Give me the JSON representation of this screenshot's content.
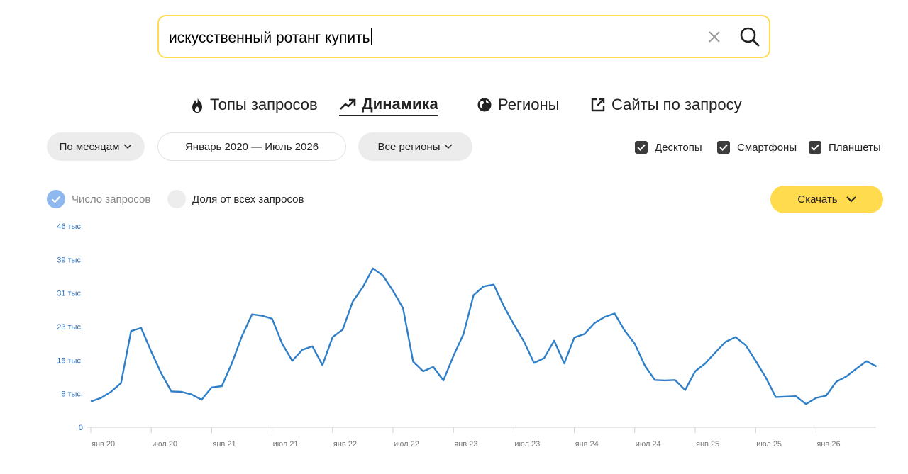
{
  "search": {
    "query": "искусственный ротанг купить"
  },
  "tabs": [
    {
      "label": "Топы запросов",
      "icon": "fire-icon"
    },
    {
      "label": "Динамика",
      "icon": "trend-icon",
      "active": true
    },
    {
      "label": "Регионы",
      "icon": "globe-icon"
    },
    {
      "label": "Сайты по запросу",
      "icon": "external-link-icon"
    }
  ],
  "filters": {
    "period": "По месяцам",
    "range": "Январь 2020 — Июль 2026",
    "region": "Все регионы"
  },
  "devices": [
    {
      "label": "Десктопы",
      "checked": true
    },
    {
      "label": "Смартфоны",
      "checked": true
    },
    {
      "label": "Планшеты",
      "checked": true
    }
  ],
  "modes": [
    {
      "label": "Число запросов",
      "selected": true
    },
    {
      "label": "Доля от всех запросов",
      "selected": false
    }
  ],
  "download_label": "Скачать",
  "colors": {
    "accent": "#ffdb4d",
    "line": "#2f7fc8",
    "tick_y": "#2d6fbd",
    "radio_on": "#8eb8ee"
  },
  "chart_data": {
    "type": "line",
    "title": "",
    "xlabel": "",
    "ylabel": "",
    "ylim": [
      0,
      46000
    ],
    "yticks": [
      0,
      7700,
      15300,
      23000,
      30700,
      38300,
      46000
    ],
    "ytick_labels": [
      "0",
      "8 тыс.",
      "15 тыс.",
      "23 тыс.",
      "31 тыс.",
      "39 тыс.",
      "46 тыс."
    ],
    "x_start": "2020-01",
    "xtick_labels": [
      "янв 20",
      "июл 20",
      "янв 21",
      "июл 21",
      "янв 22",
      "июл 22",
      "янв 23",
      "июл 23",
      "янв 24",
      "июл 24",
      "янв 25",
      "июл 25",
      "янв 26"
    ],
    "grid": false,
    "series": [
      {
        "values": [
          5900,
          6700,
          8100,
          10100,
          22000,
          22700,
          17300,
          12300,
          8200,
          8100,
          7500,
          6300,
          9100,
          9400,
          14600,
          20800,
          25800,
          25500,
          24800,
          19100,
          15200,
          17700,
          18500,
          14200,
          20600,
          22300,
          28700,
          32000,
          36300,
          34700,
          31200,
          27200,
          15000,
          12800,
          13800,
          10700,
          16300,
          21300,
          30200,
          32200,
          32600,
          27700,
          23500,
          19600,
          14700,
          15800,
          19800,
          14600,
          20500,
          21300,
          23800,
          25200,
          26000,
          22100,
          19100,
          14100,
          10800,
          10700,
          10800,
          8500,
          12800,
          14600,
          17100,
          19500,
          20600,
          18800,
          15200,
          11400,
          6900,
          7000,
          7100,
          5300,
          6700,
          7200,
          10400,
          11600,
          13400,
          15100,
          13900
        ]
      }
    ]
  }
}
